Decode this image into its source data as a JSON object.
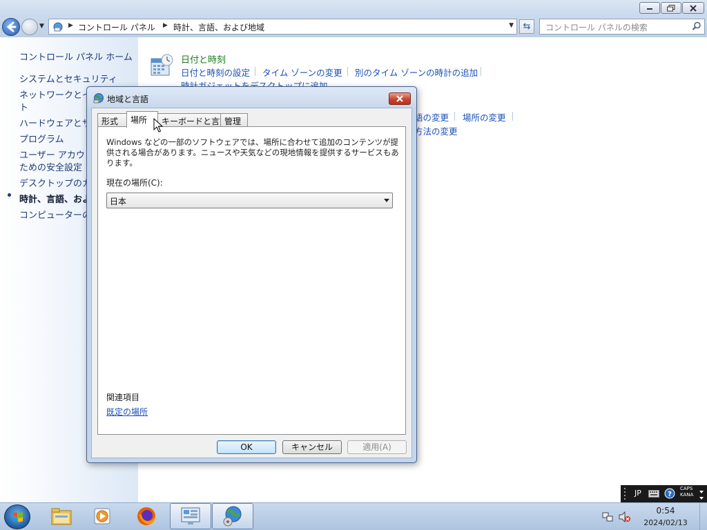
{
  "window": {
    "address": {
      "crumb1": "コントロール パネル",
      "crumb2": "時計、言語、および地域"
    },
    "search_placeholder": "コントロール パネルの検索",
    "nav": {
      "home": "コントロール パネル ホーム",
      "items": [
        "システムとセキュリティ",
        "ネットワークとイ",
        "ト",
        "ハードウェアとサ",
        "プログラム",
        "ユーザー アカウン",
        "ための安全設定",
        "デスクトップのカ",
        "時計、言語、およ",
        "コンピューターの"
      ]
    },
    "category": {
      "title": "日付と時刻",
      "links": [
        "日付と時刻の設定",
        "タイム ゾーンの変更",
        "別のタイム ゾーンの時計の追加",
        "時計ガジェットをデスクトップに追加"
      ],
      "partial_links": [
        "語の変更",
        "場所の変更",
        "方法の変更"
      ]
    }
  },
  "dialog": {
    "title": "地域と言語",
    "tabs": [
      "形式",
      "場所",
      "キーボードと言語",
      "管理"
    ],
    "active_tab": "場所",
    "description": "Windows などの一部のソフトウェアでは、場所に合わせて追加のコンテンツが提供される場合があります。ニュースや天気などの現地情報を提供するサービスもあります。",
    "location_label": "現在の場所(C):",
    "location_value": "日本",
    "related_header": "関連項目",
    "related_link": "既定の場所",
    "buttons": {
      "ok": "OK",
      "cancel": "キャンセル",
      "apply": "適用(A)"
    }
  },
  "taskbar": {
    "language": "JP",
    "caps": "CAPS",
    "kana": "KANA",
    "time": "0:54",
    "date": "2024/02/13"
  },
  "colors": {
    "link": "#1b50b8",
    "category_title": "#1b7a1b",
    "nav_text": "#1e3a78",
    "dialog_frame": "#c4d6eb",
    "close_red": "#c8452f"
  }
}
